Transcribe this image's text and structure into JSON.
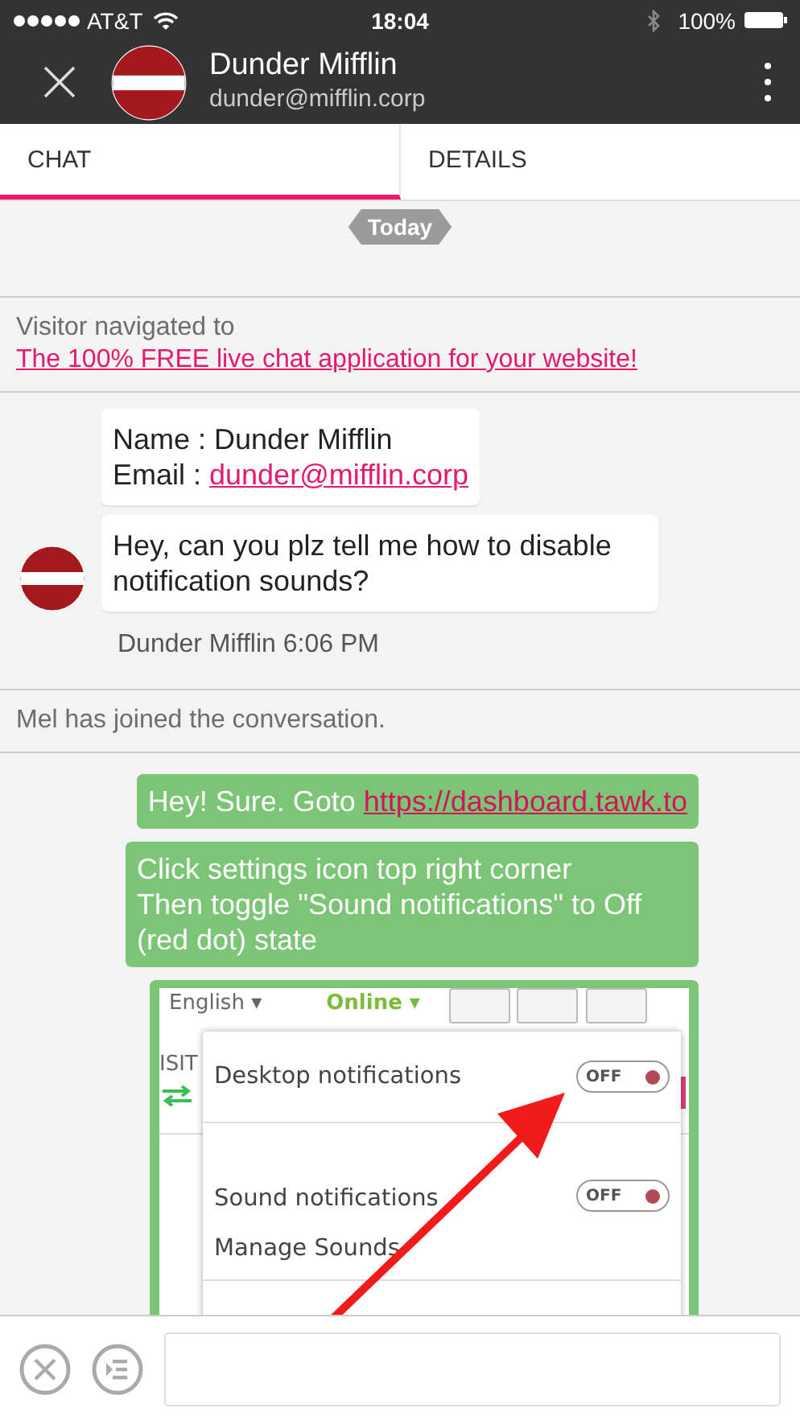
{
  "status_bar": {
    "carrier": "AT&T",
    "time": "18:04",
    "battery": "100%"
  },
  "header": {
    "name": "Dunder Mifflin",
    "email": "dunder@mifflin.corp"
  },
  "tabs": [
    {
      "label": "CHAT",
      "selected": true
    },
    {
      "label": "DETAILS",
      "selected": false
    }
  ],
  "chat": {
    "date_label": "Today",
    "items": [
      {
        "kind": "notice",
        "text": "Visitor navigated to",
        "link": "The 100% FREE live chat application for your website!"
      },
      {
        "kind": "visitor",
        "bubbles": [
          {
            "kind": "info",
            "name_label": "Name :",
            "name": "Dunder Mifflin",
            "email_label": "Email :",
            "email": "dunder@mifflin.corp"
          },
          {
            "kind": "text",
            "lines": [
              "Hey, can you plz tell me how to disable notification sounds?"
            ]
          }
        ],
        "meta": "Dunder Mifflin 6:06 PM"
      },
      {
        "kind": "notice",
        "text": "Mel has joined the conversation."
      },
      {
        "kind": "agent",
        "bubbles": [
          {
            "kind": "link_text",
            "text": "Hey! Sure. Goto",
            "link": "https://dashboard.tawk.to"
          },
          {
            "kind": "text",
            "lines": [
              "Click settings icon top right corner",
              "Then toggle \"Sound notifications\" to Off (red dot) state"
            ]
          },
          {
            "kind": "screenshot",
            "language": "English ▾",
            "status": "Online ▾",
            "tab_fragment": "ISIT",
            "menu": [
              {
                "kind": "toggle",
                "label": "Desktop notifications",
                "on": false,
                "state_label": "OFF"
              },
              {
                "kind": "toggle",
                "label": "Sound notifications",
                "on": false,
                "state_label": "OFF"
              },
              {
                "kind": "link",
                "label": "Manage Sounds"
              }
            ]
          }
        ]
      }
    ]
  }
}
